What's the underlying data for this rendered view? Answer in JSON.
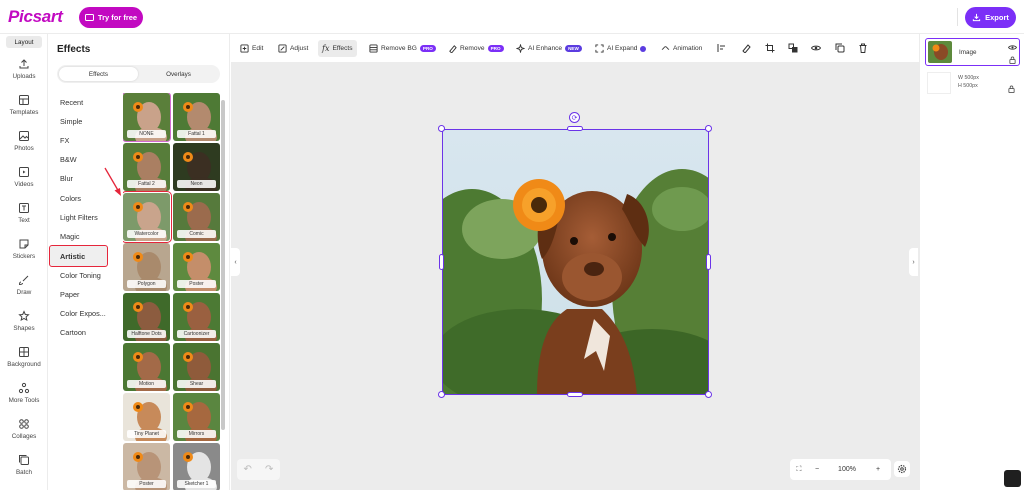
{
  "app": {
    "logo": "Picsart",
    "try_label": "Try for free",
    "export_label": "Export",
    "brand_color": "#c209c1",
    "accent_color": "#7b2ff7"
  },
  "rail": {
    "layout_label": "Layout",
    "items": [
      {
        "label": "Uploads",
        "icon": "upload-icon"
      },
      {
        "label": "Templates",
        "icon": "templates-icon"
      },
      {
        "label": "Photos",
        "icon": "photos-icon"
      },
      {
        "label": "Videos",
        "icon": "videos-icon"
      },
      {
        "label": "Text",
        "icon": "text-icon"
      },
      {
        "label": "Stickers",
        "icon": "sticker-icon"
      },
      {
        "label": "Draw",
        "icon": "brush-icon"
      },
      {
        "label": "Shapes",
        "icon": "star-icon"
      },
      {
        "label": "Background",
        "icon": "background-icon"
      },
      {
        "label": "More Tools",
        "icon": "tools-icon"
      },
      {
        "label": "Collages",
        "icon": "collage-icon"
      },
      {
        "label": "Batch",
        "icon": "batch-icon"
      }
    ]
  },
  "effects": {
    "title": "Effects",
    "tabs": [
      "Effects",
      "Overlays"
    ],
    "active_tab": "Effects",
    "categories": [
      "Recent",
      "Simple",
      "FX",
      "B&W",
      "Blur",
      "Colors",
      "Light Filters",
      "Magic",
      "Artistic",
      "Color Toning",
      "Paper",
      "Color Expos...",
      "Cartoon"
    ],
    "active_category": "Artistic",
    "thumbs": [
      "NONE",
      "Fattal 1",
      "Fattal 2",
      "Neon",
      "Watercolor",
      "Comic",
      "Polygon",
      "Poster",
      "Halftone Dots",
      "Cartoonizer",
      "Motion",
      "Shear",
      "Tiny Planet",
      "Mirrors",
      "Poster",
      "Sketcher 1"
    ]
  },
  "toolbar": {
    "edit": "Edit",
    "adjust": "Adjust",
    "effects": "Effects",
    "remove_bg": "Remove BG",
    "remove": "Remove",
    "ai_enhance": "AI Enhance",
    "ai_expand": "AI Expand",
    "animation": "Animation",
    "pro_badge": "PRO",
    "new_badge": "NEW"
  },
  "canvas": {
    "zoom": "100%",
    "zoom_minus": "−",
    "zoom_plus": "+"
  },
  "layers": {
    "image_label": "Image",
    "bg_w": "W  500px",
    "bg_h": "H  500px"
  }
}
